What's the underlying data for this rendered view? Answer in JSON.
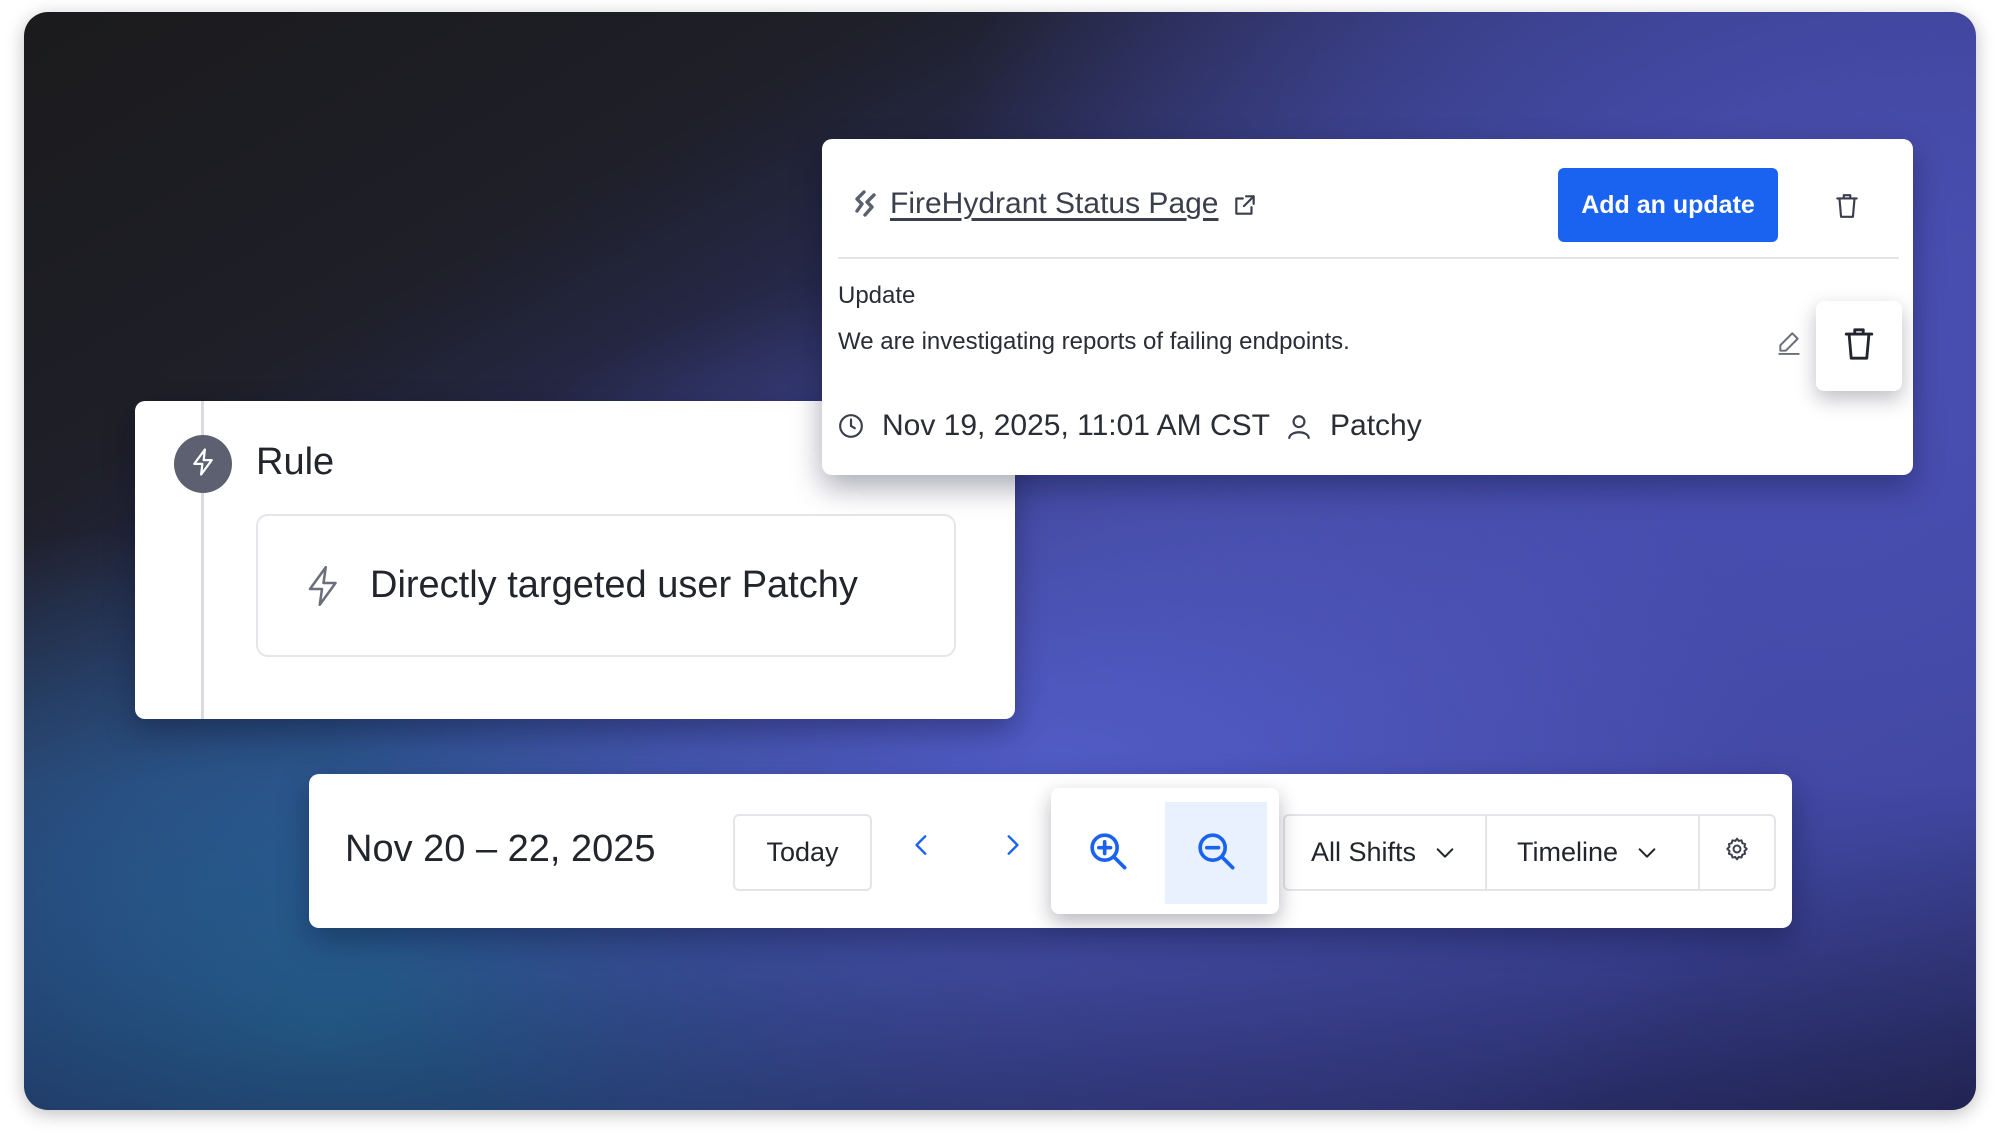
{
  "rule": {
    "title": "Rule",
    "icon": "bolt-icon",
    "condition": "Directly targeted user Patchy"
  },
  "status_page": {
    "logo_icon": "firehydrant-logo-icon",
    "link_label": "FireHydrant Status Page",
    "add_button_label": "Add an update",
    "update_heading": "Update",
    "update_message": "We are investigating reports of failing endpoints.",
    "timestamp": "Nov 19, 2025, 11:01 AM CST",
    "author": "Patchy",
    "colors": {
      "primary": "#1a63f0"
    }
  },
  "calendar": {
    "date_range": "Nov 20 – 22, 2025",
    "today_label": "Today",
    "shifts_filter": "All Shifts",
    "view_mode": "Timeline",
    "active_zoom": "zoom-out",
    "colors": {
      "accent": "#1a63f0",
      "zoom_active_bg": "#e9f1fe"
    }
  }
}
